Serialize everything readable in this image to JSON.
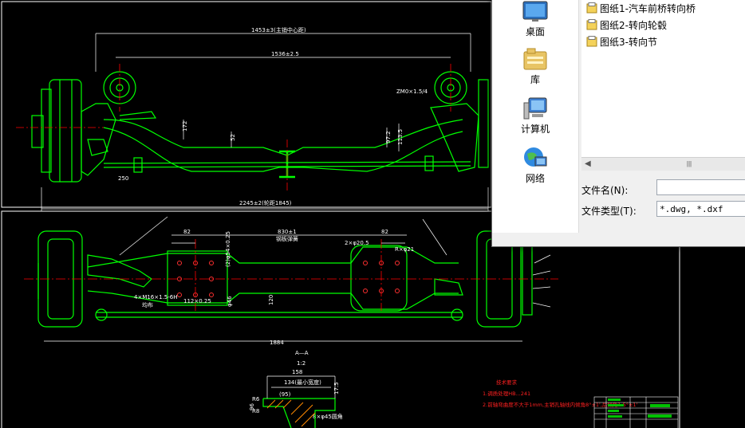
{
  "drawing": {
    "dims": {
      "overall_top": "1453±3(主销中心距)",
      "spring_center": "1536±2.5",
      "track": "2245±2(轮距1845)",
      "thread": "ZM0×1.5/4",
      "dim_172": "172",
      "dim_52": "52",
      "dim_972": "97.2",
      "dim_1135": "113.5",
      "dim_250": "250",
      "plan_830": "830±1",
      "plan_830_note": "钢板弹簧",
      "plan_82a": "82",
      "plan_82b": "82",
      "plan_hole": "2×φ20.5",
      "plan_bolt": "4×M16×1.5-6H",
      "plan_bolt_note": "均布",
      "plan_112": "112×0.25",
      "plan_120": "120",
      "plan_phi": "φ46",
      "plan_1884": "1884",
      "plan_side": "(2)φ54×0.25",
      "plan_r": "R×φ21"
    },
    "section": {
      "name": "A—A",
      "scale": "1:2",
      "d158": "158",
      "d134": "134(最小宽度)",
      "d95": "(95)",
      "d175": "17.5",
      "d96": "96",
      "r6": "R6",
      "r8": "R8",
      "chamfer": "8×φ45圆角"
    },
    "notes": {
      "title": "技术要求",
      "line1": "1.调质处理HB...241",
      "line2": "2.前轴弯曲度不大于1mm,主销孔轴线内倾角8°±1',后倾角1.5°±1'"
    }
  },
  "dialog": {
    "places": [
      {
        "label": "桌面",
        "icon": "desktop-icon"
      },
      {
        "label": "库",
        "icon": "library-icon"
      },
      {
        "label": "计算机",
        "icon": "computer-icon"
      },
      {
        "label": "网络",
        "icon": "network-icon"
      }
    ],
    "files": [
      {
        "name": "图纸1-汽车前桥转向桥"
      },
      {
        "name": "图纸2-转向轮毂"
      },
      {
        "name": "图纸3-转向节"
      }
    ],
    "filename_label": "文件名(N):",
    "filename_value": "",
    "filetype_label": "文件类型(T):",
    "filetype_value": "*.dwg, *.dxf"
  },
  "colors": {
    "cad_bg": "#000000",
    "line_green": "#00ff00",
    "centerline_red": "#ff0000",
    "dim_white": "#ffffff"
  }
}
